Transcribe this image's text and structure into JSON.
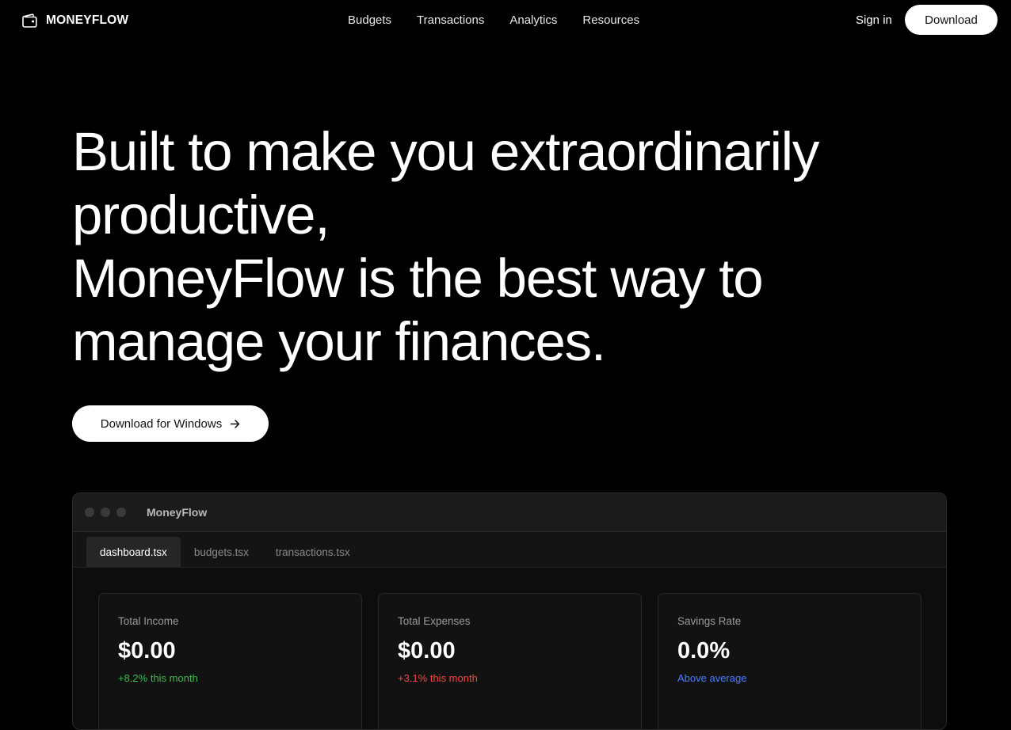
{
  "nav": {
    "brand": "MONEYFLOW",
    "links": [
      "Budgets",
      "Transactions",
      "Analytics",
      "Resources"
    ],
    "signin": "Sign in",
    "download": "Download"
  },
  "hero": {
    "lines": [
      "Built to make you extraordinarily",
      "productive,",
      "MoneyFlow is the best way to",
      "manage your finances."
    ],
    "cta": "Download for Windows"
  },
  "app": {
    "title": "MoneyFlow",
    "tabs": [
      "dashboard.tsx",
      "budgets.tsx",
      "transactions.tsx"
    ],
    "active_tab": "dashboard.tsx",
    "cards": [
      {
        "label": "Total Income",
        "value": "$0.00",
        "sub": "+8.2% this month",
        "sub_color": "#3fb950"
      },
      {
        "label": "Total Expenses",
        "value": "$0.00",
        "sub": "+3.1% this month",
        "sub_color": "#f04848"
      },
      {
        "label": "Savings Rate",
        "value": "0.0%",
        "sub": "Above average",
        "sub_color": "#4d7cff"
      }
    ]
  },
  "colors": {
    "background": "#000000",
    "button_bg": "#ffffff",
    "income_green": "#3fb950",
    "expense_red": "#f04848",
    "savings_blue": "#4d7cff"
  },
  "icons": {
    "brand": "wallet-icon",
    "cta": "arrow-right-icon"
  }
}
